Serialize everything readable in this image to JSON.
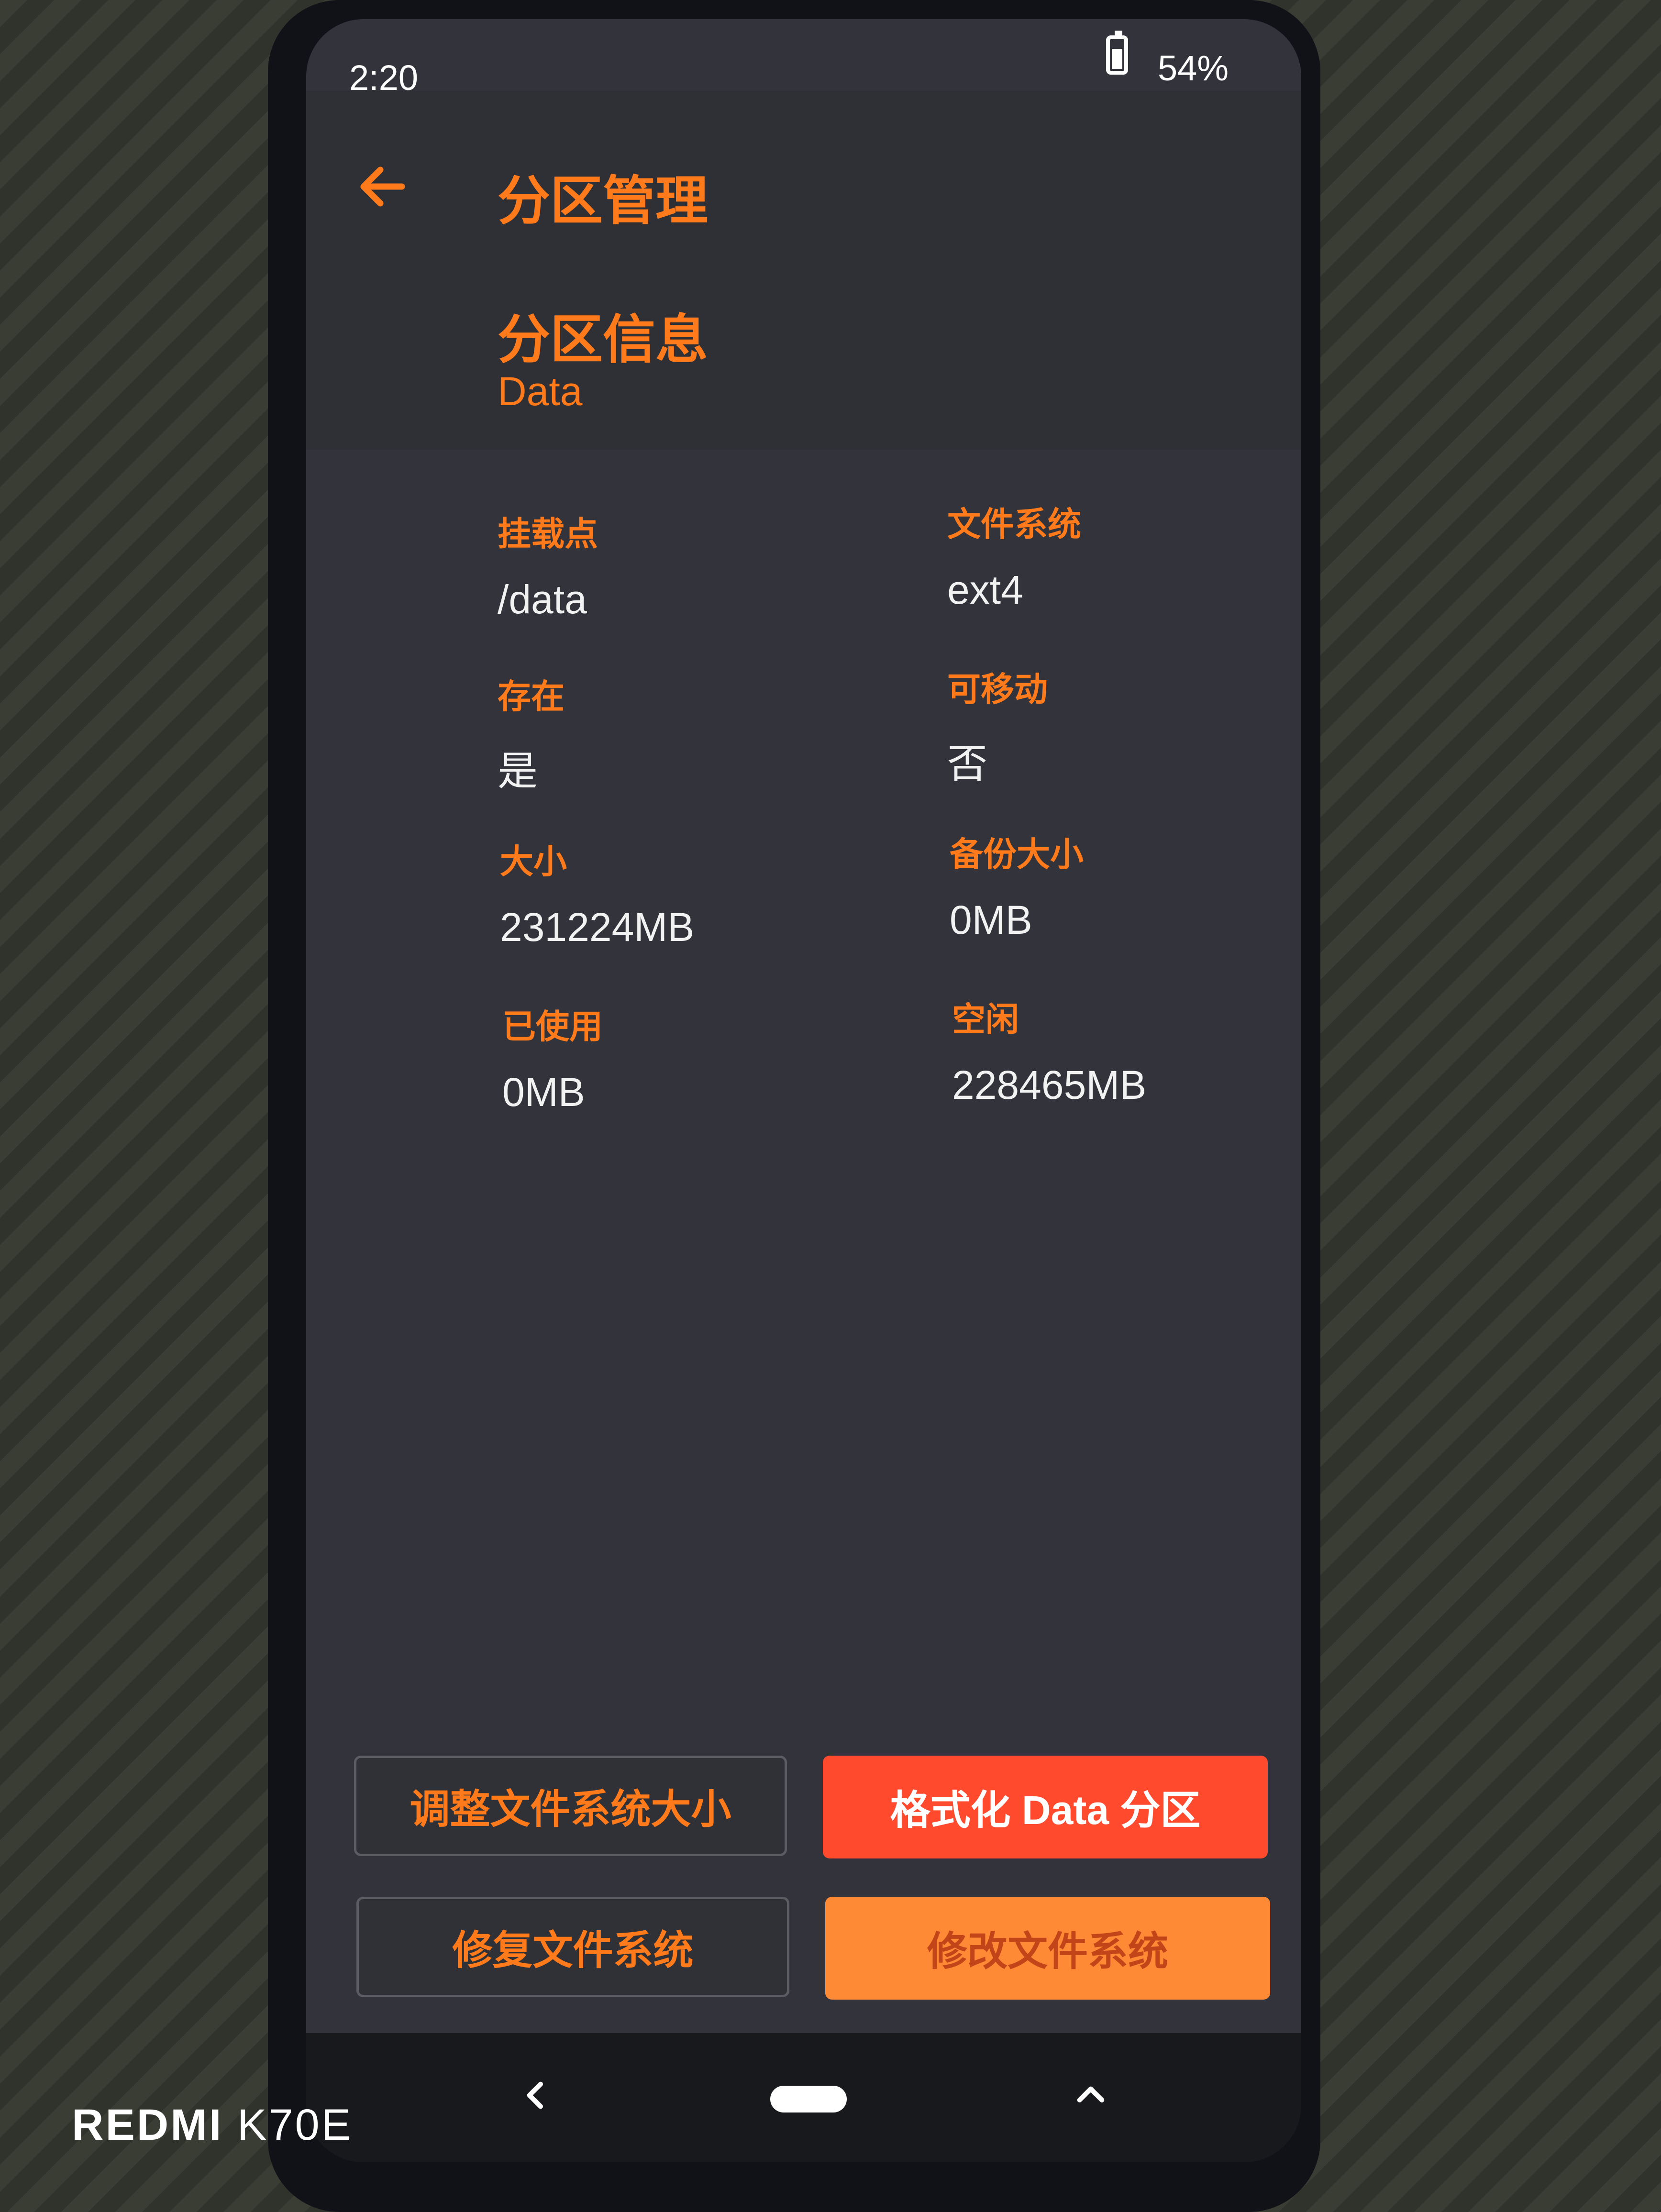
{
  "status_bar": {
    "time": "2:20",
    "battery": "54%"
  },
  "header": {
    "title": "分区管理",
    "back_icon": "arrow-left-icon"
  },
  "partition": {
    "section_title": "分区信息",
    "name": "Data"
  },
  "info": {
    "mount_point": {
      "label": "挂载点",
      "value": "/data"
    },
    "file_system": {
      "label": "文件系统",
      "value": "ext4"
    },
    "present": {
      "label": "存在",
      "value": "是"
    },
    "removable": {
      "label": "可移动",
      "value": "否"
    },
    "size": {
      "label": "大小",
      "value": "231224MB"
    },
    "backup_size": {
      "label": "备份大小",
      "value": "0MB"
    },
    "used": {
      "label": "已使用",
      "value": "0MB"
    },
    "free": {
      "label": "空闲",
      "value": "228465MB"
    }
  },
  "actions": {
    "resize": "调整文件系统大小",
    "format": "格式化 Data 分区",
    "repair": "修复文件系统",
    "change_fs": "修改文件系统"
  },
  "nav": {
    "back_icon": "chevron-left-icon",
    "home_icon": "home-pill-icon",
    "up_icon": "chevron-up-icon"
  },
  "watermark": {
    "brand": "REDMI",
    "model": "K70E"
  },
  "colors": {
    "accent": "#ff7a1a",
    "danger": "#ff4a2e",
    "warn": "#ff8a36",
    "background": "#33343b"
  }
}
